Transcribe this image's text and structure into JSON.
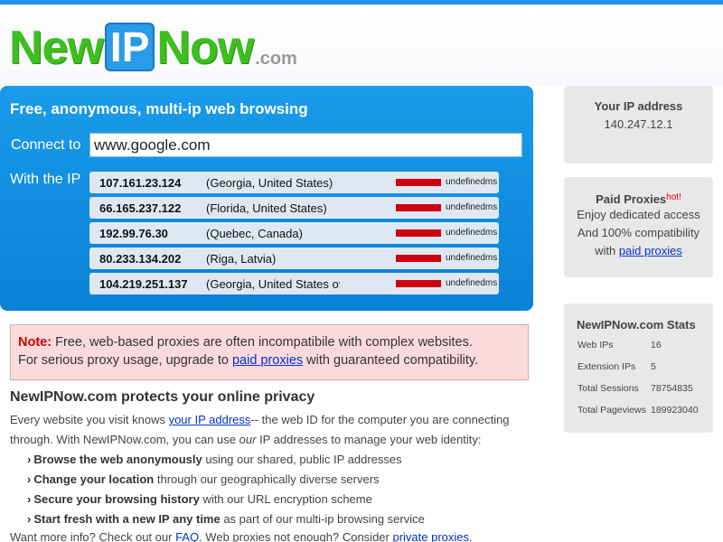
{
  "header": {
    "logo_new": "New",
    "logo_ip": "IP",
    "logo_now": "Now",
    "logo_com": ".com"
  },
  "panel": {
    "title": "Free, anonymous, multi-ip web browsing",
    "connect_label": "Connect to",
    "url_value": "www.google.com",
    "withip_label": "With the IP",
    "ips": [
      {
        "ip": "107.161.23.124",
        "location": "(Georgia, United States)",
        "ms": "undefinedms"
      },
      {
        "ip": "66.165.237.122",
        "location": "(Florida, United States)",
        "ms": "undefinedms"
      },
      {
        "ip": "192.99.76.30",
        "location": "(Quebec, Canada)",
        "ms": "undefinedms"
      },
      {
        "ip": "80.233.134.202",
        "location": "(Riga, Latvia)",
        "ms": "undefinedms"
      },
      {
        "ip": "104.219.251.137",
        "location": "(Georgia, United States of America)",
        "ms": "undefinedms"
      }
    ],
    "bar_color": "#cc0010"
  },
  "note": {
    "head": "Note:",
    "line1": " Free, web-based proxies are often incompatibile with complex websites.",
    "line2_pre": "For serious proxy usage, upgrade to ",
    "line2_link": "paid proxies",
    "line2_post": " with guaranteed compatibility."
  },
  "privacy": {
    "title": "NewIPNow.com protects your online privacy",
    "p1_pre": "Every website you visit knows ",
    "p1_link": "your IP address",
    "p1_mid": "-- the web ID for the computer you are connecting through. With NewIPNow.com, you can use ",
    "p1_em": "our",
    "p1_post": " IP addresses to manage your web identity:",
    "features": [
      {
        "bold": "Browse the web anonymously",
        "rest": " using our shared, public IP addresses"
      },
      {
        "bold": "Change your location",
        "rest": " through our geographically diverse servers"
      },
      {
        "bold": "Secure your browsing history",
        "rest": " with our URL encryption scheme"
      },
      {
        "bold": "Start fresh with a new IP any time",
        "rest": " as part of our multi-ip browsing service"
      }
    ],
    "more_pre": "Want more info? Check out our ",
    "more_faq": "FAQ",
    "more_mid": ". Web proxies not enough? Consider ",
    "more_link": "private proxies",
    "more_post": "."
  },
  "sidebar": {
    "ip_title": "Your IP address",
    "ip_value": "140.247.12.1",
    "paid_title": "Paid Proxies",
    "paid_hot": "hot!",
    "paid_line1": "Enjoy dedicated access",
    "paid_line2": "And 100% compatibility",
    "paid_line3_pre": "with ",
    "paid_line3_link": "paid proxies",
    "stats_title": "NewIPNow.com Stats",
    "stats": [
      {
        "key": "Web IPs",
        "value": "16"
      },
      {
        "key": "Extension IPs",
        "value": "5"
      },
      {
        "key": "Total Sessions",
        "value": "78754835"
      },
      {
        "key": "Total Pageviews",
        "value": "189923040"
      }
    ]
  }
}
